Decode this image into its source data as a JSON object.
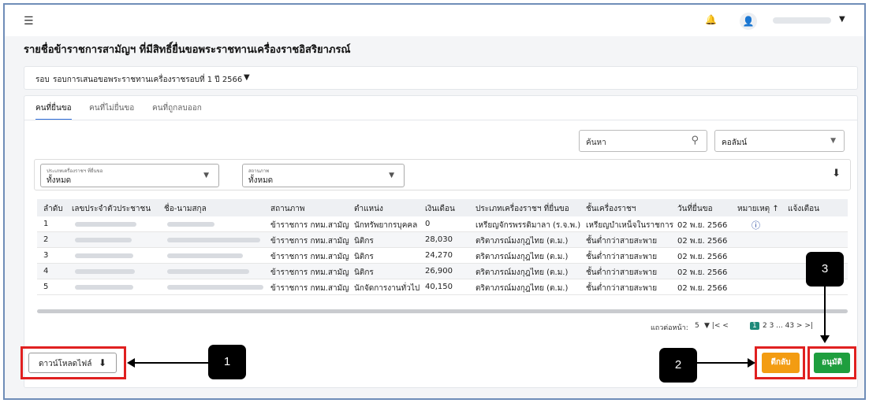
{
  "header": {
    "menu_icon": "☰",
    "bell_icon": "🔔",
    "user_icon": "👤",
    "caret": "▼"
  },
  "page": {
    "title": "รายชื่อข้าราชการสามัญฯ ที่มีสิทธิ์ยื่นขอพระราชทานเครื่องราชอิสริยาภรณ์"
  },
  "round": {
    "label": "รอบ",
    "value": "รอบการเสนอขอพระราชทานเครื่องราชรอบที่ 1 ปี 2566"
  },
  "tabs": [
    "คนที่ยื่นขอ",
    "คนที่ไม่ยื่นขอ",
    "คนที่ถูกลบออก"
  ],
  "search": {
    "placeholder": "ค้นหา",
    "column_select": "คอลัมน์"
  },
  "filters": {
    "type_label": "ประเภทเครื่องราชฯ ที่ยื่นขอ",
    "type_value": "ทั้งหมด",
    "status_label": "สถานภาพ",
    "status_value": "ทั้งหมด"
  },
  "table": {
    "headers": [
      "ลำดับ",
      "เลขประจำตัวประชาชน",
      "ชื่อ-นามสกุล",
      "สถานภาพ",
      "ตำแหน่ง",
      "เงินเดือน",
      "ประเภทเครื่องราชฯ ที่ยื่นขอ",
      "ชั้นเครื่องราชฯ",
      "วันที่ยื่นขอ",
      "หมายเหตุ ↑",
      "แจ้งเตือน"
    ],
    "rows": [
      [
        "1",
        "",
        "",
        "ข้าราชการ กทม.สามัญ",
        "นักทรัพยากรบุคคล",
        "0",
        "เหรียญจักรพรรดิมาลา (ร.จ.พ.)",
        "เหรียญบำเหน็จในราชการ",
        "02 พ.ย. 2566"
      ],
      [
        "2",
        "",
        "",
        "ข้าราชการ กทม.สามัญ",
        "นิติกร",
        "28,030",
        "ตริตาภรณ์มงกุฎไทย (ต.ม.)",
        "ชั้นต่ำกว่าสายสะพาย",
        "02 พ.ย. 2566"
      ],
      [
        "3",
        "",
        "",
        "ข้าราชการ กทม.สามัญ",
        "นิติกร",
        "24,270",
        "ตริตาภรณ์มงกุฎไทย (ต.ม.)",
        "ชั้นต่ำกว่าสายสะพาย",
        "02 พ.ย. 2566"
      ],
      [
        "4",
        "",
        "",
        "ข้าราชการ กทม.สามัญ",
        "นิติกร",
        "26,900",
        "ตริตาภรณ์มงกุฎไทย (ต.ม.)",
        "ชั้นต่ำกว่าสายสะพาย",
        "02 พ.ย. 2566"
      ],
      [
        "5",
        "",
        "",
        "ข้าราชการ กทม.สามัญ",
        "นักจัดการงานทั่วไป",
        "40,150",
        "ตริตาภรณ์มงกุฎไทย (ต.ม.)",
        "ชั้นต่ำกว่าสายสะพาย",
        "02 พ.ย. 2566"
      ]
    ],
    "info_icon": "ⓘ"
  },
  "pagination": {
    "rows_label": "แถวต่อหน้า:",
    "rows_value": "5",
    "controls": "▼   |<   <",
    "current": "1",
    "rest": "2   3   ...   43   >   >|"
  },
  "buttons": {
    "download": "ดาวน์โหลดไฟล์",
    "download_icon": "⬇",
    "back": "ตีกลับ",
    "approve": "อนุมัติ"
  },
  "callouts": [
    "1",
    "2",
    "3"
  ],
  "colors": {
    "accent": "#2e6dd8",
    "back": "#f39c12",
    "approve": "#1e9e3e",
    "highlight": "#e02020"
  }
}
